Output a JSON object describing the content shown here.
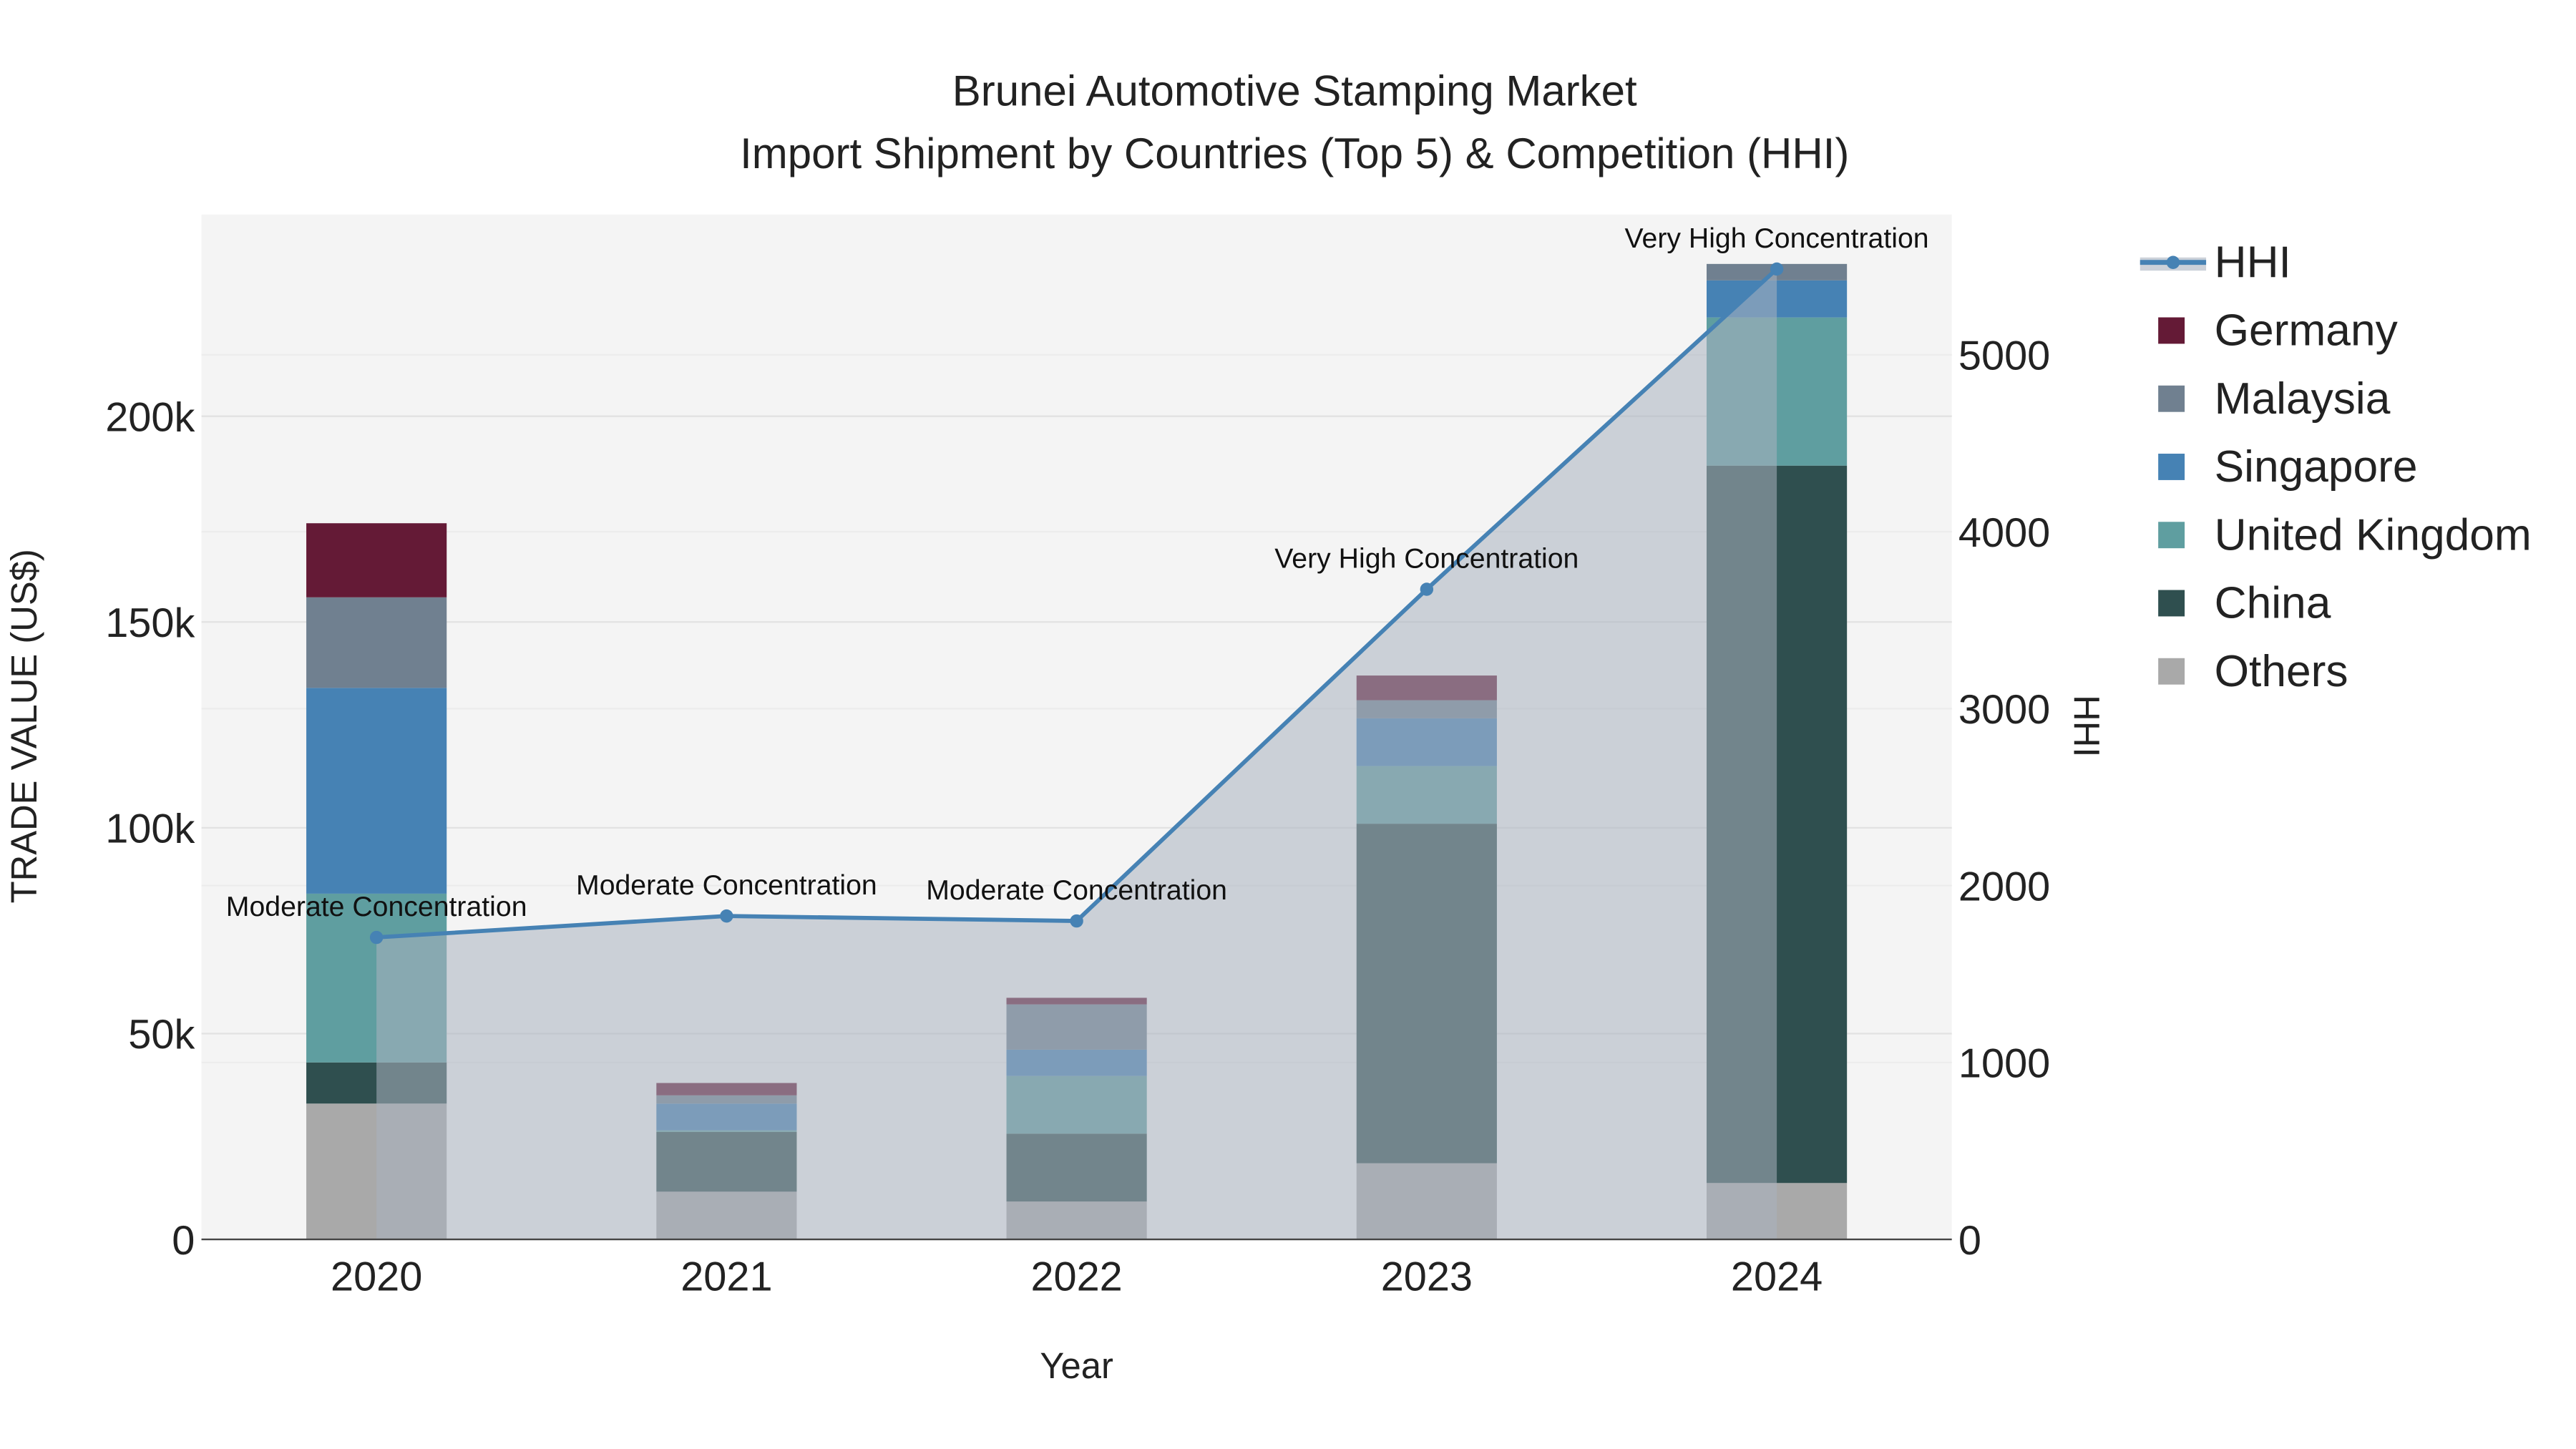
{
  "chart_data": {
    "type": "bar",
    "title": "Brunei Automotive Stamping Market",
    "subtitle": "Import Shipment by Countries (Top 5) & Competition (HHI)",
    "xlabel": "Year",
    "ylabel": "TRADE VALUE (US$)",
    "y2label": "HHI",
    "categories": [
      "2020",
      "2021",
      "2022",
      "2023",
      "2024"
    ],
    "ylim": [
      0,
      249000
    ],
    "y2lim": [
      0,
      5793
    ],
    "yticks": [
      {
        "v": 0,
        "label": "0"
      },
      {
        "v": 50000,
        "label": "50k"
      },
      {
        "v": 100000,
        "label": "100k"
      },
      {
        "v": 150000,
        "label": "150k"
      },
      {
        "v": 200000,
        "label": "200k"
      }
    ],
    "y2ticks": [
      {
        "v": 0,
        "label": "0"
      },
      {
        "v": 1000,
        "label": "1000"
      },
      {
        "v": 2000,
        "label": "2000"
      },
      {
        "v": 3000,
        "label": "3000"
      },
      {
        "v": 4000,
        "label": "4000"
      },
      {
        "v": 5000,
        "label": "5000"
      }
    ],
    "grid": true,
    "legend_position": "right",
    "stacked": true,
    "series": [
      {
        "name": "Others",
        "color": "#a9a9a9",
        "values": [
          33000,
          11600,
          9200,
          18500,
          13700
        ]
      },
      {
        "name": "China",
        "color": "#2f4f4f",
        "values": [
          10000,
          14500,
          16500,
          82500,
          174300
        ]
      },
      {
        "name": "United Kingdom",
        "color": "#5f9ea0",
        "values": [
          41000,
          400,
          14000,
          14000,
          36000
        ]
      },
      {
        "name": "Singapore",
        "color": "#4682b4",
        "values": [
          50000,
          6500,
          6400,
          11600,
          9000
        ]
      },
      {
        "name": "Malaysia",
        "color": "#708090",
        "values": [
          22000,
          2000,
          11000,
          4400,
          4000
        ]
      },
      {
        "name": "Germany",
        "color": "#641a36",
        "values": [
          18000,
          3000,
          1600,
          6000,
          0
        ]
      }
    ],
    "hhi": {
      "name": "HHI",
      "color": "#4682b4",
      "values": [
        1707,
        1828,
        1800,
        3675,
        5485
      ],
      "annotations": [
        "Moderate Concentration",
        "Moderate Concentration",
        "Moderate Concentration",
        "Very High Concentration",
        "Very High Concentration"
      ]
    },
    "legend": [
      "HHI",
      "Germany",
      "Malaysia",
      "Singapore",
      "United Kingdom",
      "China",
      "Others"
    ]
  }
}
